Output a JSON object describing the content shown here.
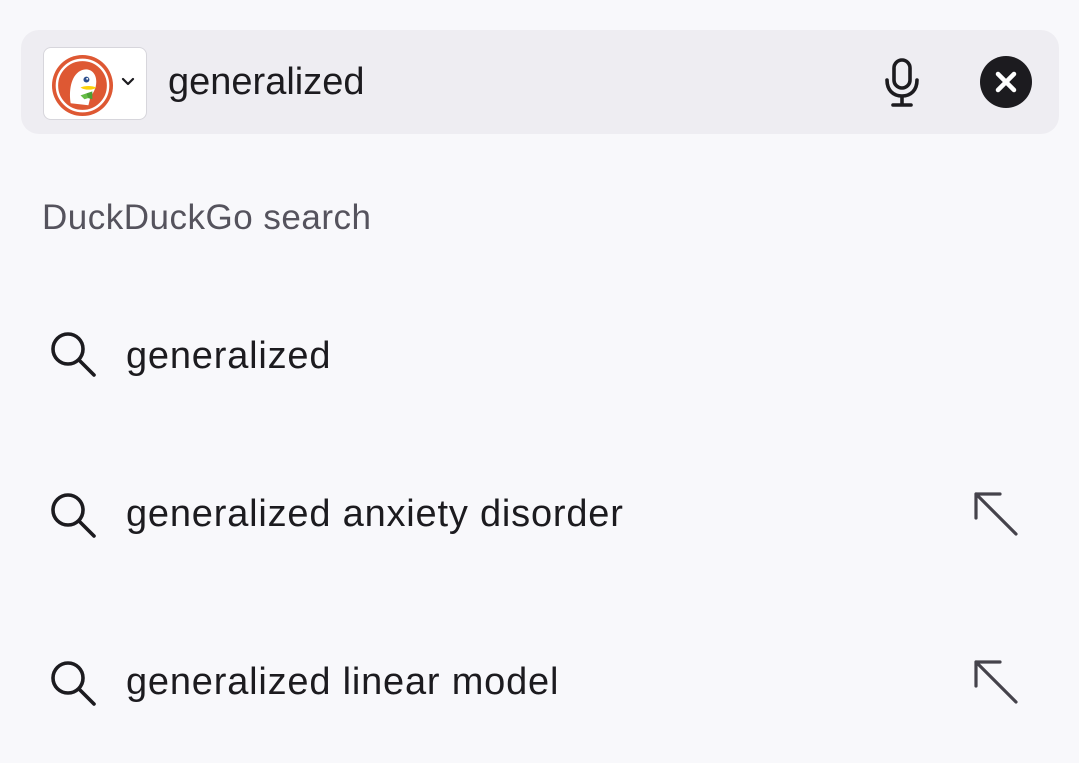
{
  "search_bar": {
    "engine_icon": "duckduckgo-logo",
    "engine_dropdown_icon": "chevron-down-icon",
    "query": "generalized",
    "mic_icon": "microphone-icon",
    "clear_icon": "clear-icon"
  },
  "section": {
    "label": "DuckDuckGo search"
  },
  "suggestions": [
    {
      "text": "generalized",
      "icon": "search-icon",
      "has_fill_arrow": false
    },
    {
      "text": "generalized anxiety disorder",
      "icon": "search-icon",
      "has_fill_arrow": true,
      "fill_icon": "arrow-up-left-icon"
    },
    {
      "text": "generalized linear model",
      "icon": "search-icon",
      "has_fill_arrow": true,
      "fill_icon": "arrow-up-left-icon"
    }
  ],
  "colors": {
    "background": "#f8f8fb",
    "search_bar_bg": "#eeedf2",
    "text_primary": "#1c1b1f",
    "text_secondary": "#55535d",
    "ddg_orange": "#de5833"
  }
}
